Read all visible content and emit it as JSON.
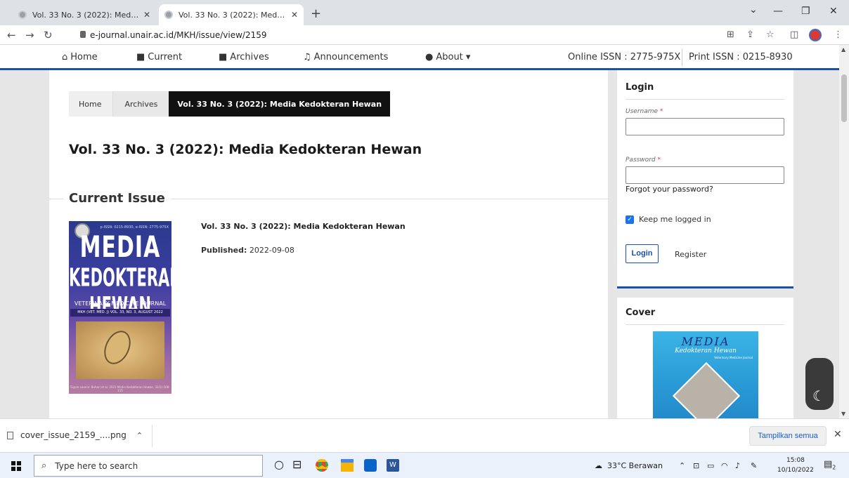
{
  "browser": {
    "tabs": [
      {
        "title": "Vol. 33 No. 3 (2022): Media Kedokteran Hewan"
      },
      {
        "title": "Vol. 33 No. 3 (2022): Media Kedokteran Hewan"
      }
    ],
    "close_glyph": "✕",
    "new_tab_glyph": "+",
    "url": "e-journal.unair.ac.id/MKH/issue/view/2159",
    "controls": {
      "minimize": "—",
      "maximize": "❐",
      "close": "✕",
      "dropdown": "⌄"
    }
  },
  "nav": {
    "items": [
      {
        "label": "Home",
        "icon": "⌂"
      },
      {
        "label": "Current",
        "icon": "■"
      },
      {
        "label": "Archives",
        "icon": "■"
      },
      {
        "label": "Announcements",
        "icon": "♫"
      },
      {
        "label": "About ▾",
        "icon": "●"
      }
    ],
    "issn_online": "Online ISSN : 2775-975X",
    "issn_print": "Print ISSN : 0215-8930"
  },
  "breadcrumb": {
    "home": "Home",
    "archives": "Archives",
    "current": "Vol. 33 No. 3 (2022): Media Kedokteran Hewan"
  },
  "issue": {
    "title": "Vol. 33 No. 3 (2022): Media Kedokteran Hewan",
    "section": "Current Issue",
    "name": "Vol. 33 No. 3 (2022): Media Kedokteran Hewan",
    "published_label": "Published:",
    "published_date": "2022-09-08"
  },
  "cover_art": {
    "top": "p-ISSN: 0215-8930, e-ISSN: 2775-975X",
    "title": "MEDIA",
    "subtitle": "KEDOKTERAN HEWAN",
    "tagline": "VETERINARY MEDICINE JOURNAL",
    "band": "MKH (VET. MED. J) VOL. 33, NO. 3, AUGUST 2022",
    "footer": "Figure source: Buhari et al. 2021 Media Kedokteran Hewan, 33(1):108-115"
  },
  "login": {
    "heading": "Login",
    "username_label": "Username",
    "password_label": "Password",
    "required_mark": "*",
    "forgot": "Forgot your password?",
    "keep": "Keep me logged in",
    "login_button": "Login",
    "register": "Register"
  },
  "cover_block": {
    "heading": "Cover",
    "title": "MEDIA",
    "subtitle": "Kedokteran Hewan",
    "tagline": "Veterinary Medicine Journal"
  },
  "download": {
    "file": "cover_issue_2159_....png",
    "show_all": "Tampilkan semua"
  },
  "taskbar": {
    "search_placeholder": "Type here to search",
    "weather": "33°C  Berawan",
    "time": "15:08",
    "date": "10/10/2022",
    "notification_count": "2"
  },
  "colors": {
    "accent": "#1d4fae",
    "breadcrumb_active": "#111111",
    "checkbox": "#1a73e8"
  }
}
